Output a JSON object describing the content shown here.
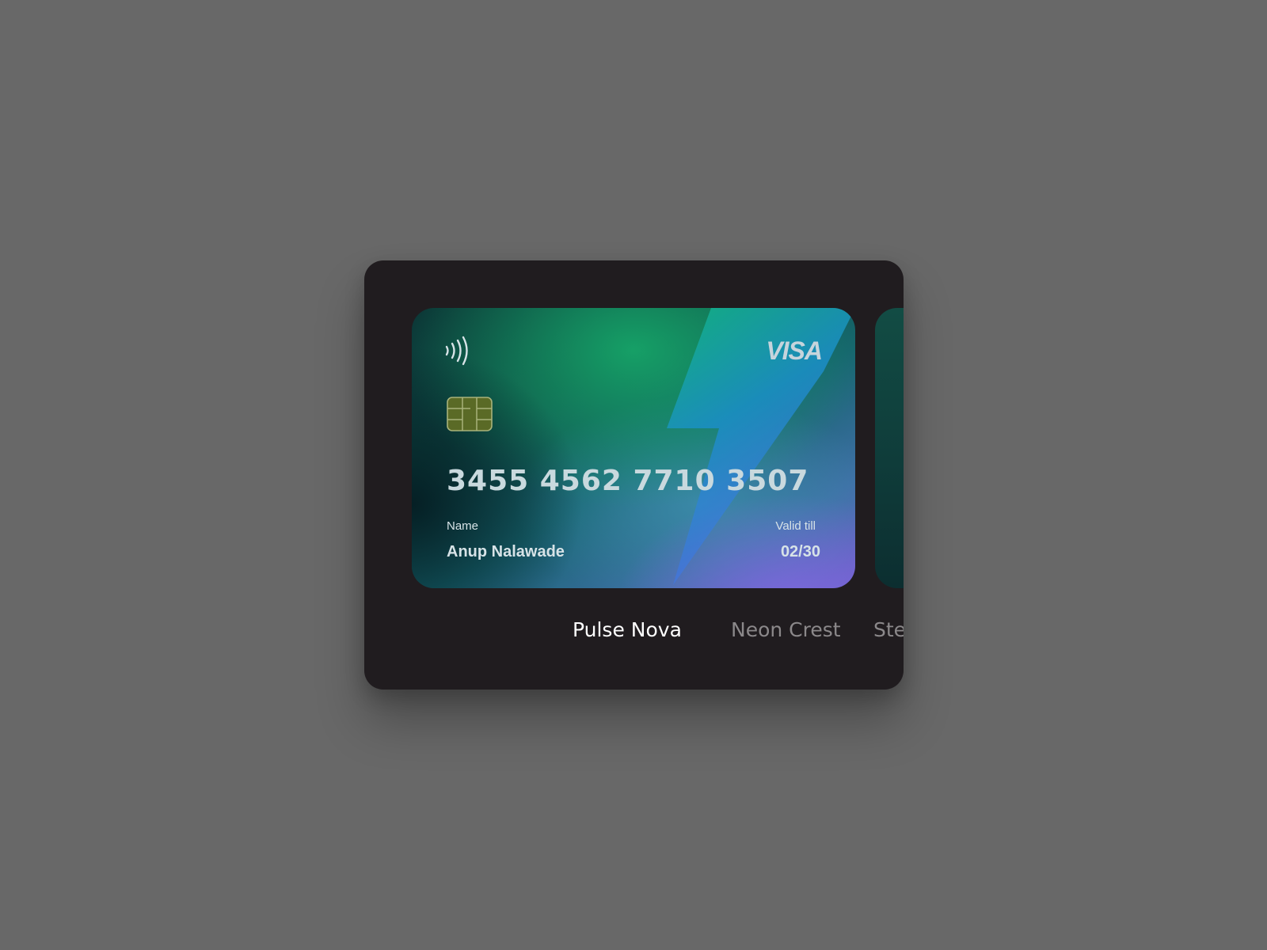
{
  "card": {
    "brand": "VISA",
    "number": "3455 4562 7710 3507",
    "name_label": "Name",
    "name": "Anup Nalawade",
    "valid_label": "Valid till",
    "valid": "02/30",
    "icons": [
      "contactless-icon",
      "chip-icon",
      "lightning-bolt-icon"
    ]
  },
  "tabs": [
    {
      "label": "Pulse Nova",
      "active": true
    },
    {
      "label": "Neon Crest",
      "active": false
    },
    {
      "label": "Ste",
      "active": false
    }
  ],
  "colors": {
    "page_background": "#686868",
    "panel_background": "#201c1f",
    "active_tab": "#ffffff",
    "inactive_tab": "#8b888a",
    "card_text": "#d7e3e7"
  }
}
